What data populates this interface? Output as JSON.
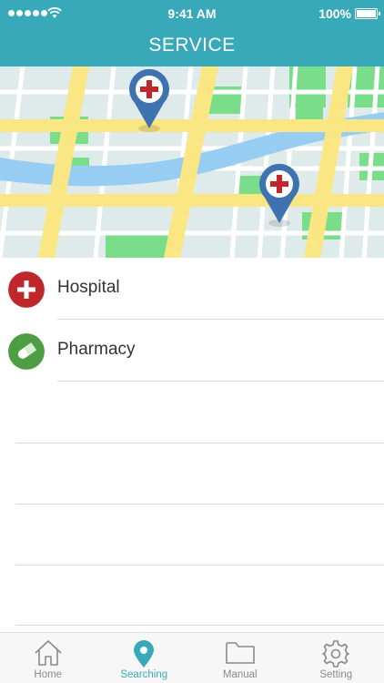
{
  "status_bar": {
    "time": "9:41 AM",
    "battery": "100%"
  },
  "header": {
    "title": "SERVICE"
  },
  "map": {
    "markers": [
      {
        "name": "hospital-marker"
      },
      {
        "name": "hospital-marker"
      }
    ]
  },
  "list": {
    "items": [
      {
        "label": "Hospital",
        "icon": "plus-icon",
        "color": "#c0272d"
      },
      {
        "label": "Pharmacy",
        "icon": "pill-icon",
        "color": "#4d9e42"
      }
    ]
  },
  "tabbar": {
    "tabs": [
      {
        "label": "Home",
        "icon": "home-icon",
        "active": false
      },
      {
        "label": "Searching",
        "icon": "location-pin-icon",
        "active": true
      },
      {
        "label": "Manual",
        "icon": "folder-icon",
        "active": false
      },
      {
        "label": "Setting",
        "icon": "gear-icon",
        "active": false
      }
    ]
  },
  "colors": {
    "primary": "#38a9b9",
    "hospital": "#c0272d",
    "pharmacy": "#4d9e42",
    "marker": "#3f72b0"
  }
}
